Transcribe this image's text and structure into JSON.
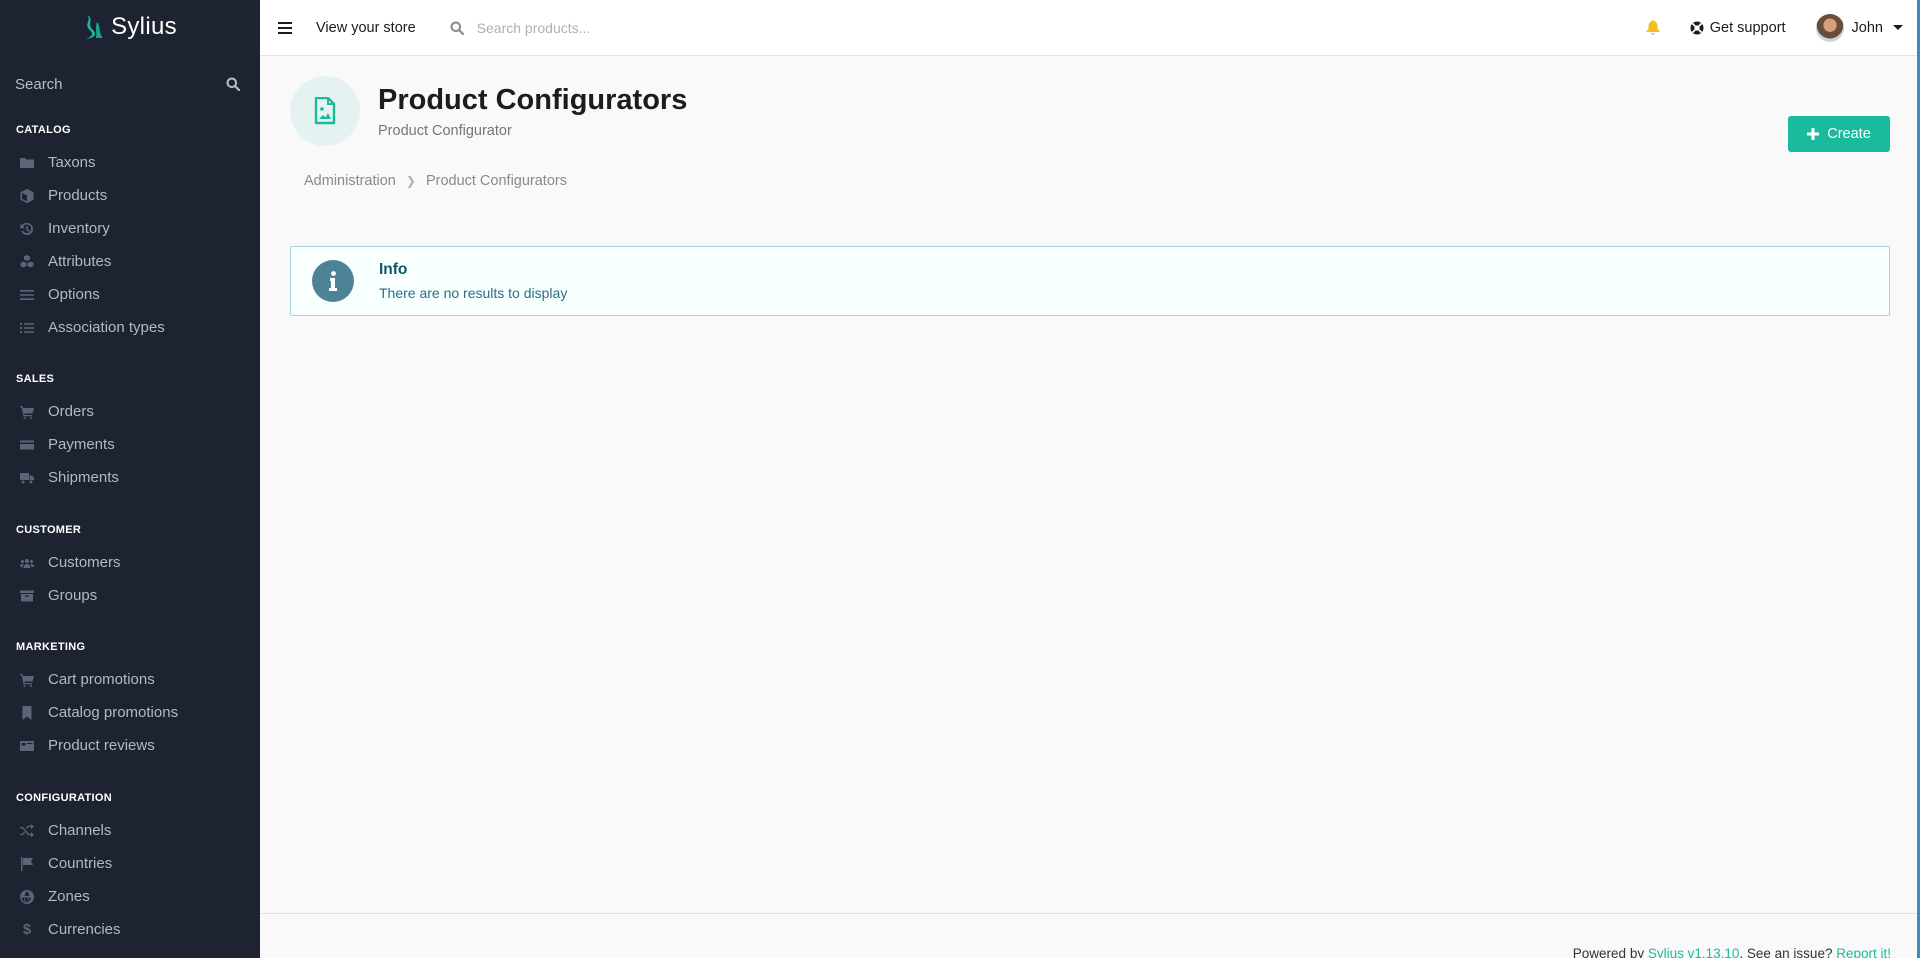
{
  "app": {
    "name": "Sylius"
  },
  "sidebar": {
    "search_label": "Search",
    "sections": [
      {
        "title": "Catalog",
        "items": [
          {
            "label": "Taxons",
            "icon": "folder-icon"
          },
          {
            "label": "Products",
            "icon": "cube-icon"
          },
          {
            "label": "Inventory",
            "icon": "history-icon"
          },
          {
            "label": "Attributes",
            "icon": "cubes-icon"
          },
          {
            "label": "Options",
            "icon": "options-icon"
          },
          {
            "label": "Association types",
            "icon": "list-icon"
          }
        ]
      },
      {
        "title": "Sales",
        "items": [
          {
            "label": "Orders",
            "icon": "cart-icon"
          },
          {
            "label": "Payments",
            "icon": "credit-card-icon"
          },
          {
            "label": "Shipments",
            "icon": "truck-icon"
          }
        ]
      },
      {
        "title": "Customer",
        "items": [
          {
            "label": "Customers",
            "icon": "users-icon"
          },
          {
            "label": "Groups",
            "icon": "archive-icon"
          }
        ]
      },
      {
        "title": "Marketing",
        "items": [
          {
            "label": "Cart promotions",
            "icon": "cart-icon"
          },
          {
            "label": "Catalog promotions",
            "icon": "bookmark-icon"
          },
          {
            "label": "Product reviews",
            "icon": "newspaper-icon"
          }
        ]
      },
      {
        "title": "Configuration",
        "items": [
          {
            "label": "Channels",
            "icon": "shuffle-icon"
          },
          {
            "label": "Countries",
            "icon": "flag-icon"
          },
          {
            "label": "Zones",
            "icon": "globe-icon"
          },
          {
            "label": "Currencies",
            "icon": "dollar-icon"
          }
        ]
      }
    ]
  },
  "topbar": {
    "view_store": "View your store",
    "search_placeholder": "Search products...",
    "support": "Get support",
    "user": "John"
  },
  "page": {
    "title": "Product Configurators",
    "subtitle": "Product Configurator",
    "create_label": "Create",
    "breadcrumb": [
      "Administration",
      "Product Configurators"
    ]
  },
  "info": {
    "title": "Info",
    "message": "There are no results to display"
  },
  "footer": {
    "powered_by": "Powered by ",
    "version_link": "Sylius v1.13.10",
    "issue_text": ". See an issue? ",
    "report_link": "Report it!"
  },
  "colors": {
    "sidebar_bg": "#1d2330",
    "accent": "#1abb9c",
    "info_title": "#0e566c"
  }
}
